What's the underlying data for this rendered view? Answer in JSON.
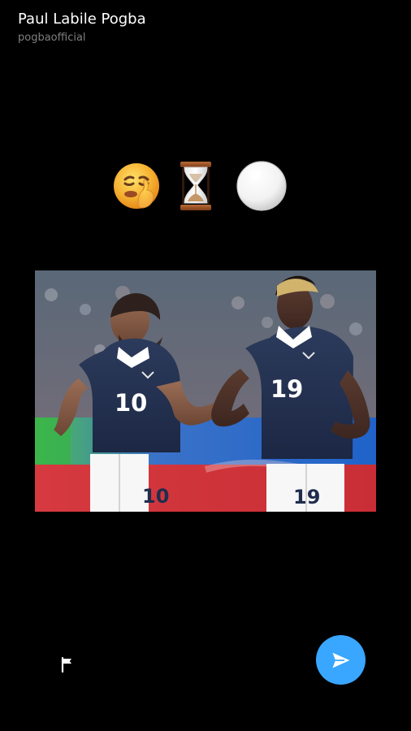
{
  "header": {
    "title": "Paul Labile Pogba",
    "username": "pogbaofficial"
  },
  "emojis": [
    {
      "name": "shushing-face-emoji",
      "glyph": "🤫"
    },
    {
      "name": "hourglass-emoji",
      "glyph": "⌛"
    },
    {
      "name": "white-circle-emoji",
      "glyph": "⚪"
    }
  ],
  "photo": {
    "players": [
      {
        "number": "10"
      },
      {
        "number": "19"
      }
    ]
  },
  "actions": {
    "report_icon": "flag-icon",
    "send_icon": "send-icon"
  },
  "colors": {
    "background": "#000000",
    "send_button": "#39a6ff",
    "username": "#7f7f7f",
    "jersey": "#23314f"
  }
}
